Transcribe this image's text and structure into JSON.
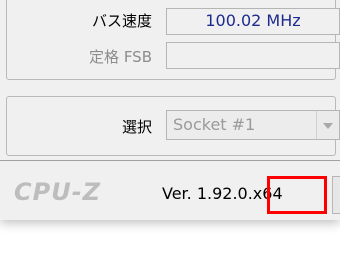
{
  "fields": {
    "bus_speed": {
      "label": "バス速度",
      "value": "100.02 MHz"
    },
    "rated_fsb": {
      "label": "定格 FSB",
      "value": ""
    }
  },
  "selection": {
    "label": "選択",
    "selected": "Socket #1",
    "dropdown_icon": "chevron-down-icon"
  },
  "footer": {
    "logo": "CPU-Z",
    "version_text": "Ver. 1.92.0.x64",
    "highlight_color": "#ff0000"
  },
  "colors": {
    "value_text": "#1e2b8e",
    "disabled_text": "#8c8c8c"
  }
}
